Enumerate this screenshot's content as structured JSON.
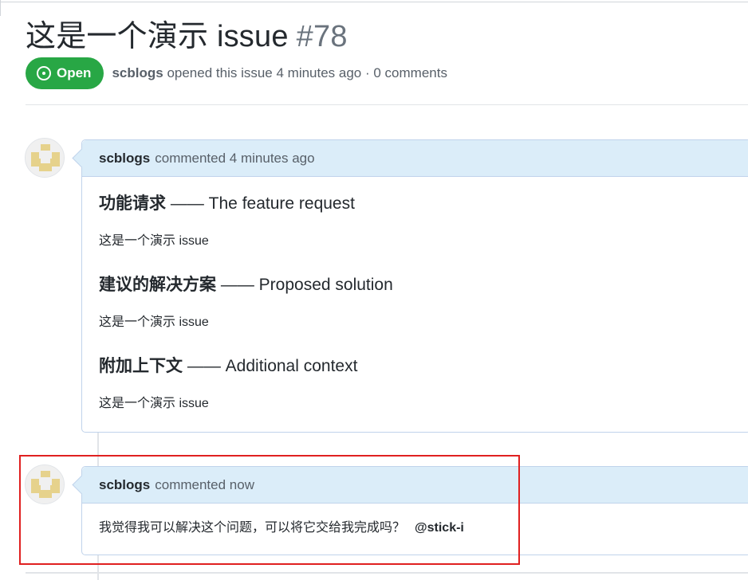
{
  "issue": {
    "title": "这是一个演示 issue",
    "number": "#78",
    "state": "Open",
    "author": "scblogs",
    "meta": "opened this issue 4 minutes ago · 0 comments"
  },
  "comments": [
    {
      "author": "scblogs",
      "timestamp": "commented 4 minutes ago",
      "sections": [
        {
          "heading_zh": "功能请求",
          "heading_rest": " —— The feature request",
          "body": "这是一个演示 issue"
        },
        {
          "heading_zh": "建议的解决方案",
          "heading_rest": " —— Proposed solution",
          "body": "这是一个演示 issue"
        },
        {
          "heading_zh": "附加上下文",
          "heading_rest": " —— Additional context",
          "body": "这是一个演示 issue"
        }
      ]
    },
    {
      "author": "scblogs",
      "timestamp": "commented now",
      "body": "我觉得我可以解决这个问题，可以将它交给我完成吗？",
      "mention": "@stick-i"
    }
  ],
  "colors": {
    "open_badge": "#28a745",
    "comment_header_bg": "#dbedf9",
    "comment_border": "#c0d3eb",
    "highlight": "#e02020",
    "avatar_identicon": "#e6d28c"
  },
  "icons": [
    "issue-opened-icon",
    "identicon-avatar"
  ]
}
